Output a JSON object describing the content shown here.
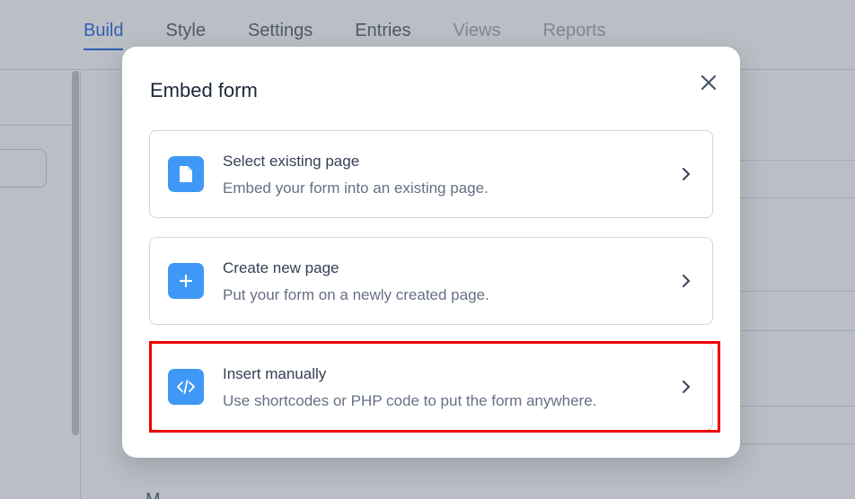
{
  "nav": {
    "tabs": [
      {
        "label": "Build",
        "state": "active"
      },
      {
        "label": "Style",
        "state": "normal"
      },
      {
        "label": "Settings",
        "state": "normal"
      },
      {
        "label": "Entries",
        "state": "normal"
      },
      {
        "label": "Views",
        "state": "disabled"
      },
      {
        "label": "Reports",
        "state": "disabled"
      }
    ]
  },
  "background": {
    "partial_text": "M"
  },
  "modal": {
    "title": "Embed form",
    "close_icon": "close-icon",
    "options": [
      {
        "icon": "page-icon",
        "title": "Select existing page",
        "description": "Embed your form into an existing page."
      },
      {
        "icon": "plus-icon",
        "title": "Create new page",
        "description": "Put your form on a newly created page."
      },
      {
        "icon": "code-icon",
        "title": "Insert manually",
        "description": "Use shortcodes or PHP code to put the form anywhere.",
        "highlighted": true
      }
    ]
  },
  "colors": {
    "accent": "#2f6fe4",
    "icon_bg": "#3f98f5",
    "highlight": "#ee0000",
    "overlay": "rgba(52,64,84,0.34)"
  }
}
